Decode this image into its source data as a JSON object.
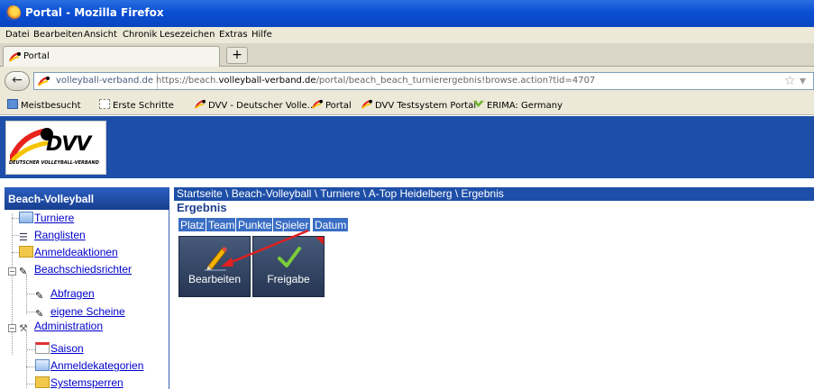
{
  "window": {
    "title": "Portal - Mozilla Firefox"
  },
  "menu": [
    "Datei",
    "Bearbeiten",
    "Ansicht",
    "Chronik",
    "Lesezeichen",
    "Extras",
    "Hilfe"
  ],
  "tab": {
    "label": "Portal",
    "new_tab": "+"
  },
  "nav": {
    "back": "←",
    "identity": "volleyball-verband.de",
    "url_prefix": "https://beach.",
    "url_domain": "volleyball-verband.de",
    "url_path": "/portal/beach_beach_turnierergebnis!browse.action?tid=4707",
    "star": "☆ ▾"
  },
  "bookmarks": [
    "Meistbesucht",
    "Erste Schritte",
    "DVV - Deutscher Volle...",
    "Portal",
    "DVV Testsystem Portal",
    "ERIMA: Germany"
  ],
  "logo": {
    "text": "DVV",
    "subtitle": "DEUTSCHER VOLLEYBALL-VERBAND"
  },
  "sidebar": {
    "title": "Beach-Volleyball",
    "items": [
      {
        "label": "Turniere"
      },
      {
        "label": "Ranglisten"
      },
      {
        "label": "Anmeldeaktionen"
      },
      {
        "label": "Beachschiedsrichter"
      },
      {
        "label": "Abfragen"
      },
      {
        "label": "eigene Scheine"
      },
      {
        "label": "Administration"
      },
      {
        "label": "Saison"
      },
      {
        "label": "Anmeldekategorien"
      },
      {
        "label": "Systemsperren"
      }
    ]
  },
  "breadcrumb": "Startseite \\ Beach-Volleyball \\ Turniere \\ A-Top Heidelberg \\ Ergebnis",
  "section_title": "Ergebnis",
  "columns": [
    "Platz",
    "Team",
    "Punkte",
    "Spieler",
    "Datum"
  ],
  "actions": {
    "edit": "Bearbeiten",
    "release": "Freigabe"
  },
  "colors": {
    "banner": "#1e4fa8",
    "annotation_arrow": "#e02020"
  }
}
